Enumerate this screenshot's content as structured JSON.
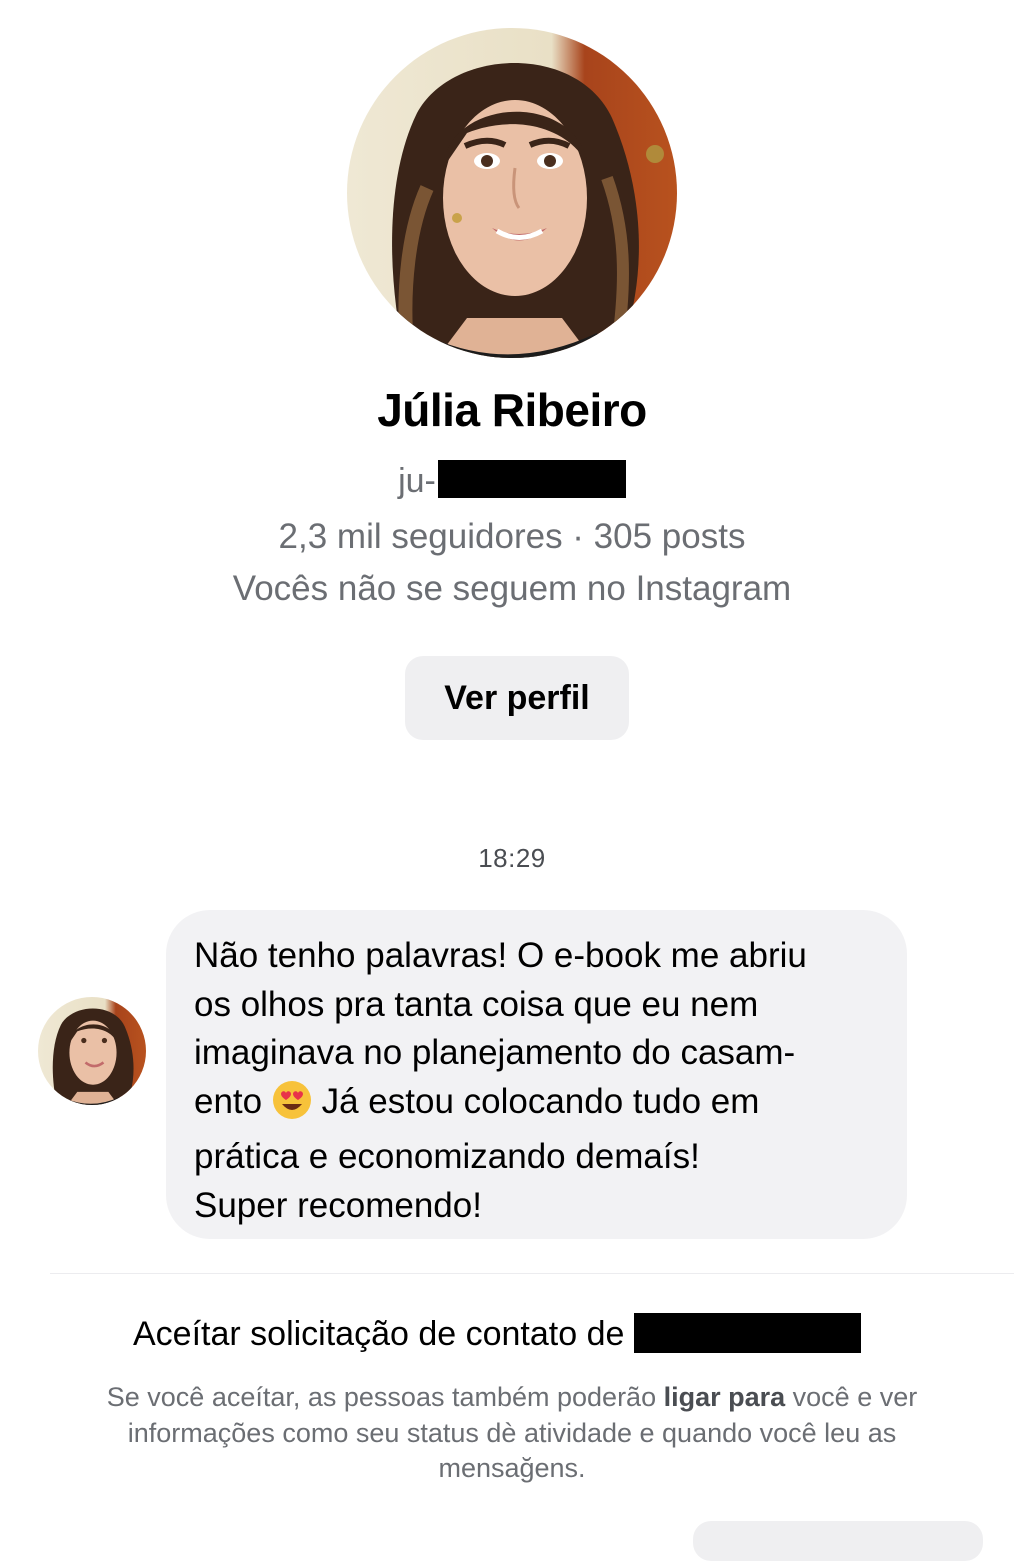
{
  "profile": {
    "name": "Júlia Ribeiro",
    "handle_prefix": "ju-",
    "stats": "2,3 mil seguidores · 305 posts",
    "follow_status": "Vocês não se seguem no Instagram",
    "view_profile_label": "Ver perfil"
  },
  "conversation": {
    "timestamp": "18:29",
    "message_lines": [
      "Não tenho palavras! O e-book me abriu",
      "os olhos pra tanta coisa que eu nem",
      "imaginava no planejamento do casam-",
      "ento",
      "Já estou colocando tudo em",
      "prática e economizando demaís!",
      "Super recomendo!"
    ],
    "emoji": "smiling-face-with-heart-eyes"
  },
  "request": {
    "title": "Aceítar solicitação de contato de",
    "desc_part1": "Se você aceítar, as pessoas também poderão ",
    "desc_bold": "ligar para",
    "desc_part2": " você e ver informações como seu status dè atividade e quando você leu as mensağens."
  },
  "colors": {
    "secondary_text": "#6b6e73",
    "bubble_bg": "#f2f2f4",
    "button_bg": "#efeff1"
  }
}
